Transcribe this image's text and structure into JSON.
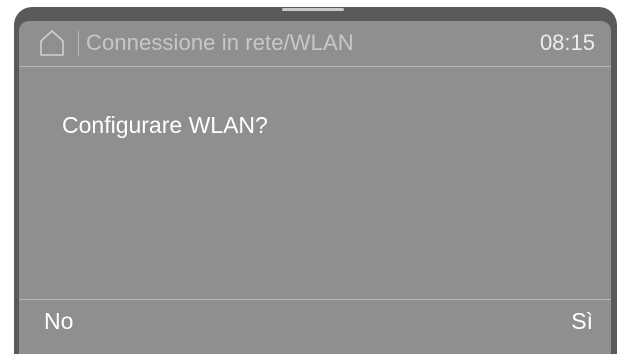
{
  "header": {
    "home_icon": "home-icon",
    "title": "Connessione in rete/WLAN",
    "time": "08:15"
  },
  "main": {
    "question": "Configurare WLAN?"
  },
  "footer": {
    "left_label": "No",
    "right_label": "Sì"
  },
  "colors": {
    "bezel": "#5a5a5a",
    "screen": "#8f8f8f",
    "text": "#ffffff",
    "title_text": "#c7c7c7"
  }
}
